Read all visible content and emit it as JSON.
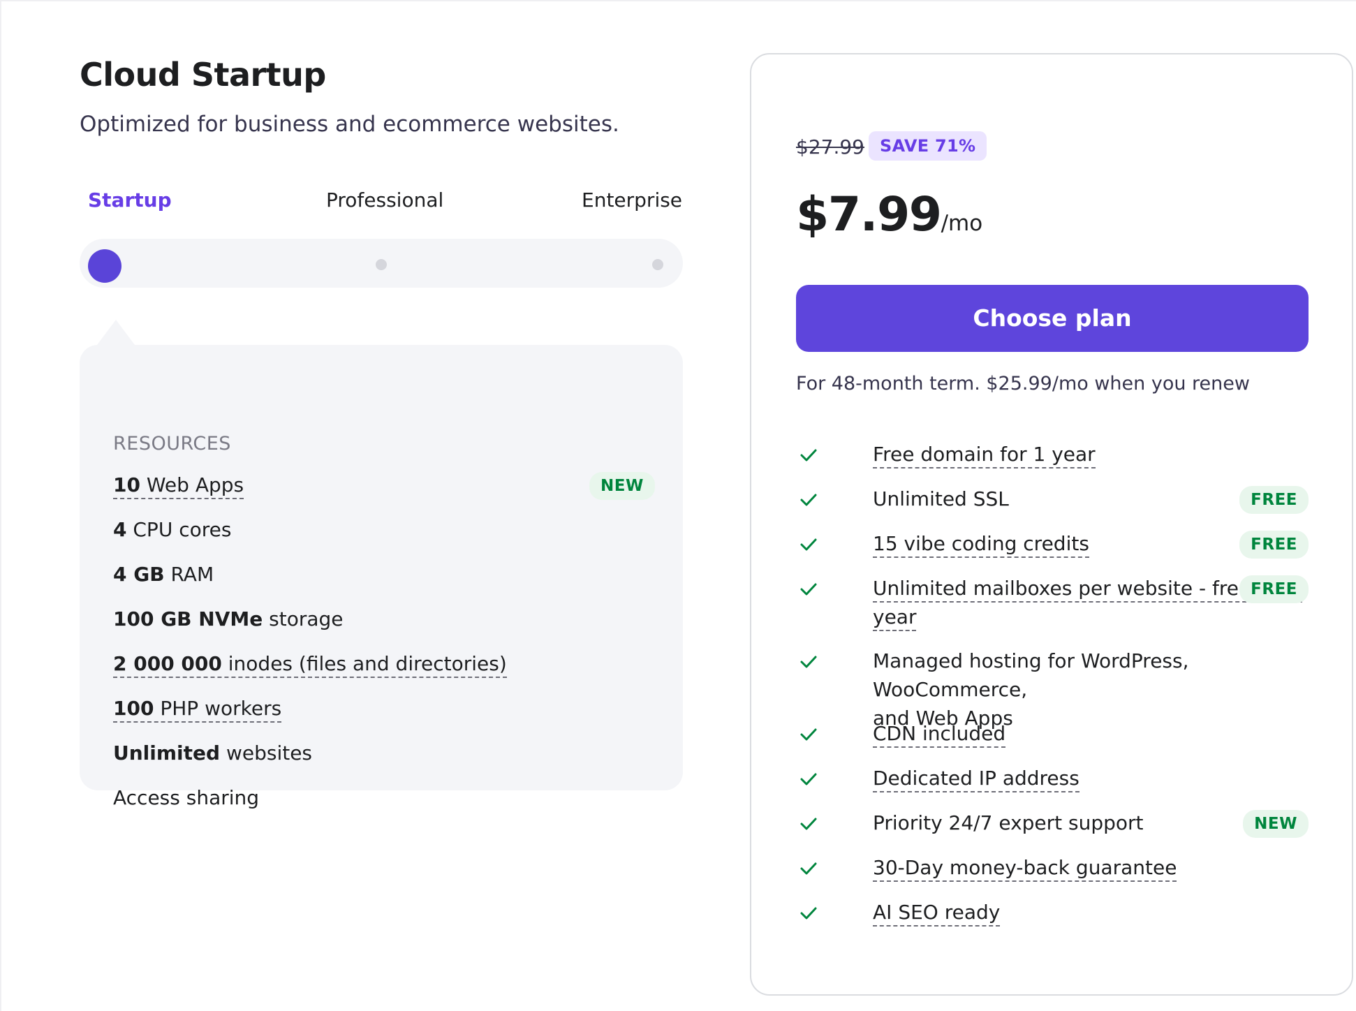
{
  "plan": {
    "title": "Cloud Startup",
    "description": "Optimized for business and ecommerce websites."
  },
  "tiers": [
    {
      "label": "Startup",
      "active": true
    },
    {
      "label": "Professional",
      "active": false
    },
    {
      "label": "Enterprise",
      "active": false
    }
  ],
  "resources": {
    "heading": "RESOURCES",
    "items": [
      {
        "bold": "10",
        "rest": " Web Apps",
        "badge": "NEW"
      },
      {
        "bold": "4",
        "rest": " CPU cores"
      },
      {
        "bold": "4 GB",
        "rest": " RAM"
      },
      {
        "bold": "100 GB NVMe",
        "rest": " storage"
      },
      {
        "bold": "2 000 000",
        "rest": " inodes (files and directories)"
      },
      {
        "bold": "100",
        "rest": " PHP workers"
      },
      {
        "bold": "Unlimited",
        "rest": " websites"
      },
      {
        "bold": "",
        "rest": "Access sharing"
      }
    ]
  },
  "pricing": {
    "old_price": "$27.99",
    "save_badge": "SAVE 71%",
    "price": "$7.99",
    "price_suffix": "/mo",
    "cta_label": "Choose plan",
    "term_note": "For 48-month term. $25.99/mo when you renew"
  },
  "features": [
    {
      "text": "Free domain for 1 year",
      "badge": ""
    },
    {
      "text": "Unlimited SSL",
      "badge": "FREE"
    },
    {
      "text": "15 vibe coding credits",
      "badge": "FREE"
    },
    {
      "text_line1": "Unlimited mailboxes per website - free for 1",
      "text_line2": "year",
      "badge": "FREE"
    },
    {
      "text_line1": "Managed hosting for WordPress, WooCommerce,",
      "text_line2": "and Web Apps",
      "badge": ""
    },
    {
      "text": "CDN included",
      "badge": ""
    },
    {
      "text": "Dedicated IP address",
      "badge": ""
    },
    {
      "text": "Priority 24/7 expert support",
      "badge": "NEW"
    },
    {
      "text": "30-Day money-back guarantee",
      "badge": ""
    },
    {
      "text": "AI SEO ready",
      "badge": ""
    }
  ],
  "colors": {
    "accent": "#673de6",
    "button": "#5e45dc",
    "badge_green_text": "#00853d",
    "badge_green_bg": "#e8f6ec",
    "check": "#00853d"
  },
  "icons": {
    "feature_check": "check-icon"
  }
}
